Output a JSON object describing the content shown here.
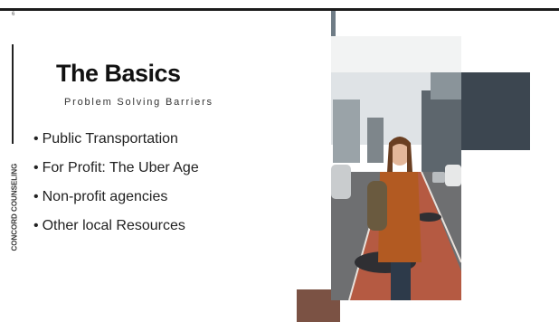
{
  "slide": {
    "number": "6",
    "title": "The Basics",
    "subtitle": "Problem Solving Barriers",
    "side_label": "CONCORD COUNSELING",
    "bullets": [
      "Public Transportation",
      "For Profit: The Uber Age",
      "Non-profit agencies",
      "Other local Resources"
    ]
  },
  "colors": {
    "title_text": "#111111",
    "body_text": "#222222",
    "rule": "#1c1c1c",
    "road": "#b55a42",
    "jacket": "#b25a22"
  }
}
